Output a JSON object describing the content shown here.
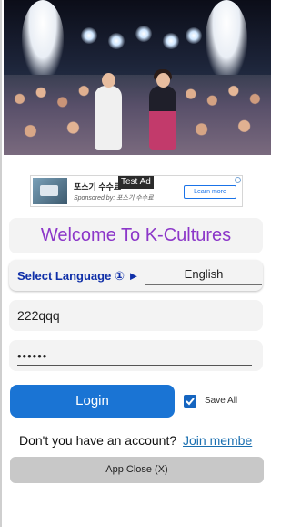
{
  "hero": {
    "alt": "concert-photo"
  },
  "ad": {
    "tag": "Test Ad",
    "title": "포스기 수수료",
    "sponsor": "Sponsored by: 포스기 수수료",
    "cta": "Learn more"
  },
  "header": {
    "title": "Welcome To K-Cultures"
  },
  "language": {
    "label": "Select Language ① ►",
    "value": "English"
  },
  "login": {
    "username": "222qqq",
    "password": "••••••",
    "button": "Login",
    "save_label": "Save All"
  },
  "signup": {
    "question": "Don't you have an account?",
    "link": "Join membe"
  },
  "footer": {
    "close_button": "App Close (X)"
  },
  "colors": {
    "accent_title": "#8c37c9",
    "primary_button": "#1a74d4",
    "language_label": "#0f2fa8",
    "link": "#1a6fb0"
  }
}
